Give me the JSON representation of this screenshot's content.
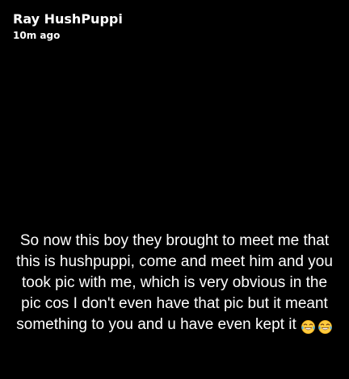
{
  "header": {
    "username": "Ray HushPuppi",
    "timestamp": "10m ago"
  },
  "caption": {
    "lines": [
      "So now this boy they brought to meet me that",
      "this is hushpuppi, come and meet him and you",
      "took pic with me, which is very obvious in the",
      "pic cos I don't even have that pic but it meant",
      "something to you and u have even kept it"
    ],
    "emojis": [
      "face-with-tears-of-joy-icon",
      "face-with-tears-of-joy-icon"
    ]
  }
}
